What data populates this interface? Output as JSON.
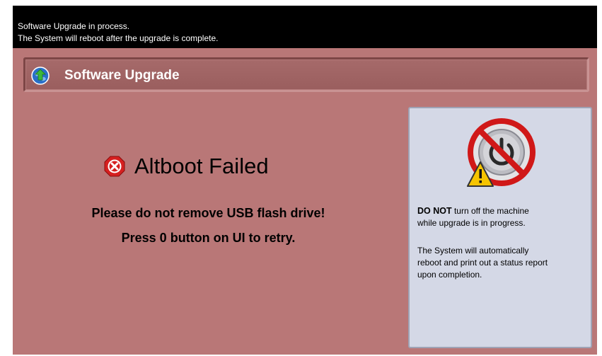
{
  "status_bar": {
    "line1": "Software Upgrade in process.",
    "line2": "The System will reboot after the upgrade is complete."
  },
  "title_bar": {
    "icon": "upgrade-globe-arrow-icon",
    "title": "Software Upgrade"
  },
  "main": {
    "error_icon": "error-x-icon",
    "error_title": "Altboot Failed",
    "message_line1": "Please do not remove USB flash drive!",
    "message_line2": "Press 0 button on UI to retry."
  },
  "info_panel": {
    "graphic": "no-power-off-warning-icon",
    "bold_prefix": "DO NOT",
    "warning_rest_line1": " turn off the machine",
    "warning_line2": "while upgrade is in progress.",
    "note_line1": "The System will automatically",
    "note_line2": "reboot and print out a status report",
    "note_line3": "upon completion."
  },
  "colors": {
    "background": "#b97777",
    "status_bar": "#000000",
    "panel": "#d4d8e6",
    "title_bar": "#a06464"
  }
}
